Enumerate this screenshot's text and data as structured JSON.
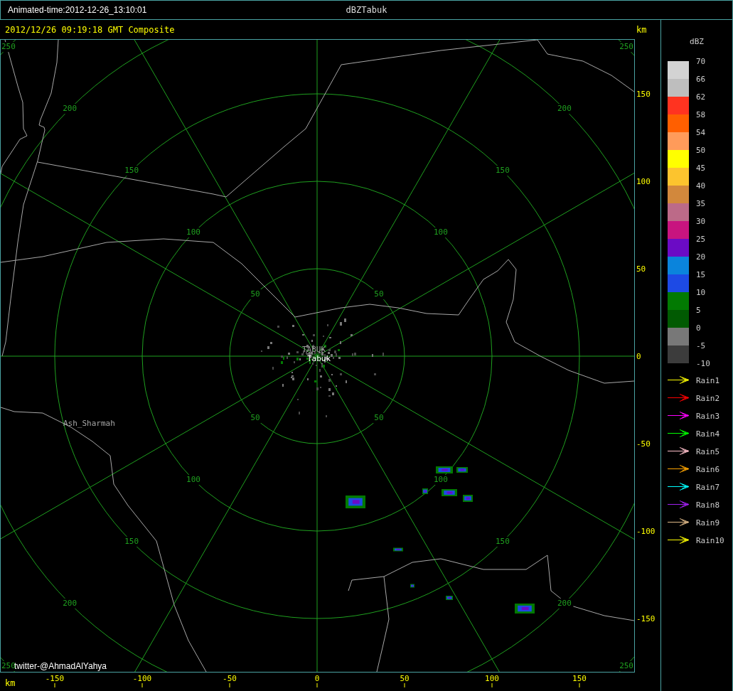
{
  "window": {
    "animated_time": "Animated-time:2012-12-26_13:10:01",
    "title": "dBZTabuk"
  },
  "plot": {
    "caption": "2012/12/26 09:19:18 GMT Composite",
    "credit": "twitter-@AhmadAlYahya",
    "range_rings": [
      {
        "labels": [
          "50",
          "50",
          "50",
          "50"
        ]
      },
      {
        "labels": [
          "100",
          "100",
          "100",
          "100"
        ]
      },
      {
        "labels": [
          "150",
          "150",
          "150",
          "150"
        ]
      },
      {
        "labels": [
          "200",
          "200",
          "200",
          "200"
        ]
      },
      {
        "labels": [
          "250",
          "250",
          "250",
          "250"
        ]
      }
    ],
    "places": [
      {
        "kind": "station",
        "label": "TABUK"
      },
      {
        "kind": "station-name",
        "label": "Tabuk"
      },
      {
        "kind": "town",
        "label": "Ash_Sharmah"
      }
    ],
    "y_axis": {
      "unit": "km",
      "ticks": [
        "150",
        "100",
        "50",
        "0",
        "-50",
        "-100",
        "-150"
      ]
    },
    "x_axis": {
      "unit": "km",
      "ticks": [
        "-150",
        "-100",
        "-50",
        "0",
        "50",
        "100",
        "150"
      ]
    }
  },
  "legend": {
    "title": "dBZ",
    "ticks": [
      "70",
      "66",
      "62",
      "58",
      "54",
      "50",
      "45",
      "40",
      "35",
      "30",
      "25",
      "20",
      "15",
      "10",
      "5",
      "0",
      "-5",
      "-10"
    ],
    "bins": [
      {
        "color": "#d3d3d3"
      },
      {
        "color": "#bebebe"
      },
      {
        "color": "#ff3320"
      },
      {
        "color": "#ff5f00"
      },
      {
        "color": "#ff9b5a"
      },
      {
        "color": "#ffff00"
      },
      {
        "color": "#fcc42e"
      },
      {
        "color": "#d2883c"
      },
      {
        "color": "#bc6a88"
      },
      {
        "color": "#c8147f"
      },
      {
        "color": "#6b0bc5"
      },
      {
        "color": "#0a84dc"
      },
      {
        "color": "#1d4ae5"
      },
      {
        "color": "#027a02"
      },
      {
        "color": "#015a02"
      },
      {
        "color": "#787878"
      },
      {
        "color": "#3c3c3c"
      }
    ],
    "tracks": [
      {
        "label": "Rain1",
        "color": "#ffff00"
      },
      {
        "label": "Rain2",
        "color": "#ff0000"
      },
      {
        "label": "Rain3",
        "color": "#ff00ff"
      },
      {
        "label": "Rain4",
        "color": "#00ff00"
      },
      {
        "label": "Rain5",
        "color": "#ffc0cb"
      },
      {
        "label": "Rain6",
        "color": "#ffa500"
      },
      {
        "label": "Rain7",
        "color": "#00ffff"
      },
      {
        "label": "Rain8",
        "color": "#a020f0"
      },
      {
        "label": "Rain9",
        "color": "#deb887"
      },
      {
        "label": "Rain10",
        "color": "#ffff00"
      }
    ]
  }
}
